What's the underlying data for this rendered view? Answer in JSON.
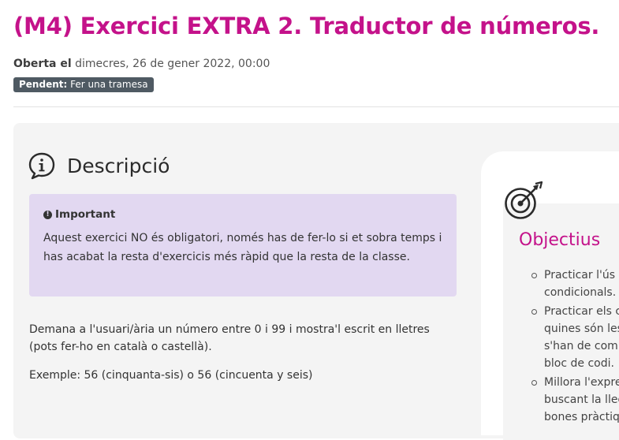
{
  "page": {
    "title": "(M4) Exercici EXTRA 2. Traductor de números.",
    "opened_label": "Oberta el",
    "opened_date": "dimecres, 26 de gener 2022, 00:00",
    "status_label": "Pendent:",
    "status_value": "Fer una tramesa"
  },
  "description": {
    "heading": "Descripció",
    "icon": "info-speech-icon",
    "alert_title": "Important",
    "alert_text": "Aquest exercici NO és obligatori, només has de fer-lo si et sobra temps i has acabat la resta d'exercicis més ràpid que la resta de la classe.",
    "paragraph_1": "Demana a l'usuari/ària un número entre 0 i 99 i mostra'l escrit en lletres (pots fer-ho en català o castellà).",
    "paragraph_2": "Exemple: 56 (cinquanta-sis) o 56 (cincuenta y seis)"
  },
  "objectives": {
    "heading": "Objectius",
    "icon": "target-icon",
    "items": [
      [
        "Practicar l'ús d",
        "condicionals."
      ],
      [
        "Practicar els c",
        "quines són les",
        "s'han de com",
        "bloc de codi."
      ],
      [
        "Millora l'expres",
        "buscant la lleg",
        "bones pràctiq"
      ]
    ]
  },
  "colors": {
    "accent": "#c4128a",
    "alert_bg": "#e2d8f1",
    "badge_bg": "#4f5a63",
    "panel_bg": "#f4f4f4"
  }
}
